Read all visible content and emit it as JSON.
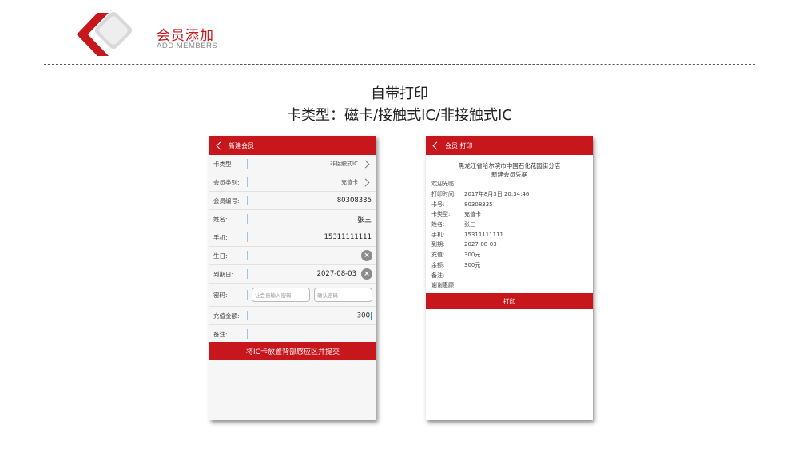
{
  "header": {
    "title_cn": "会员添加",
    "title_en": "ADD MEMBERS",
    "brand_color": "#c8161d"
  },
  "headings": {
    "line1": "自带打印",
    "line2": "卡类型：磁卡/接触式IC/非接触式IC"
  },
  "left_screen": {
    "nav_title": "新建会员",
    "fields": {
      "card_type": {
        "label": "卡类型",
        "value": "非接触式IC"
      },
      "member_category": {
        "label": "会员类别:",
        "value": "充值卡"
      },
      "member_no": {
        "label": "会员编号:",
        "value": "80308335"
      },
      "name": {
        "label": "姓名:",
        "value": "张三"
      },
      "phone": {
        "label": "手机:",
        "value": "15311111111"
      },
      "birthday": {
        "label": "生日:",
        "value": ""
      },
      "expiry": {
        "label": "到期日:",
        "value": "2027-08-03"
      },
      "password": {
        "label": "密码:",
        "placeholder": "让会员输入密码",
        "confirm_placeholder": "确认密码"
      },
      "recharge": {
        "label": "充值金额:",
        "value": "300"
      },
      "remark": {
        "label": "备注:",
        "value": ""
      }
    },
    "clear_glyph": "×",
    "submit_label": "将IC卡放置背部感应区并提交"
  },
  "right_screen": {
    "nav_title": "会员 打印",
    "receipt": {
      "store": "黑龙江省哈尔滨市中国石化花园街分店",
      "doc_title": "新建会员凭据",
      "welcome": "欢迎光临!",
      "lines": [
        {
          "k": "打印时间:",
          "v": "2017年8月3日 20:34:46"
        },
        {
          "k": "卡号:",
          "v": "80308335"
        },
        {
          "k": "卡类型:",
          "v": "充值卡"
        },
        {
          "k": "姓名:",
          "v": "张三"
        },
        {
          "k": "手机:",
          "v": "15311111111"
        },
        {
          "k": "到期:",
          "v": "2027-08-03"
        },
        {
          "k": "充值:",
          "v": "300元"
        },
        {
          "k": "余额:",
          "v": "300元"
        }
      ],
      "remark": "备注:",
      "thanks": "谢谢惠顾!"
    },
    "print_label": "打印"
  }
}
